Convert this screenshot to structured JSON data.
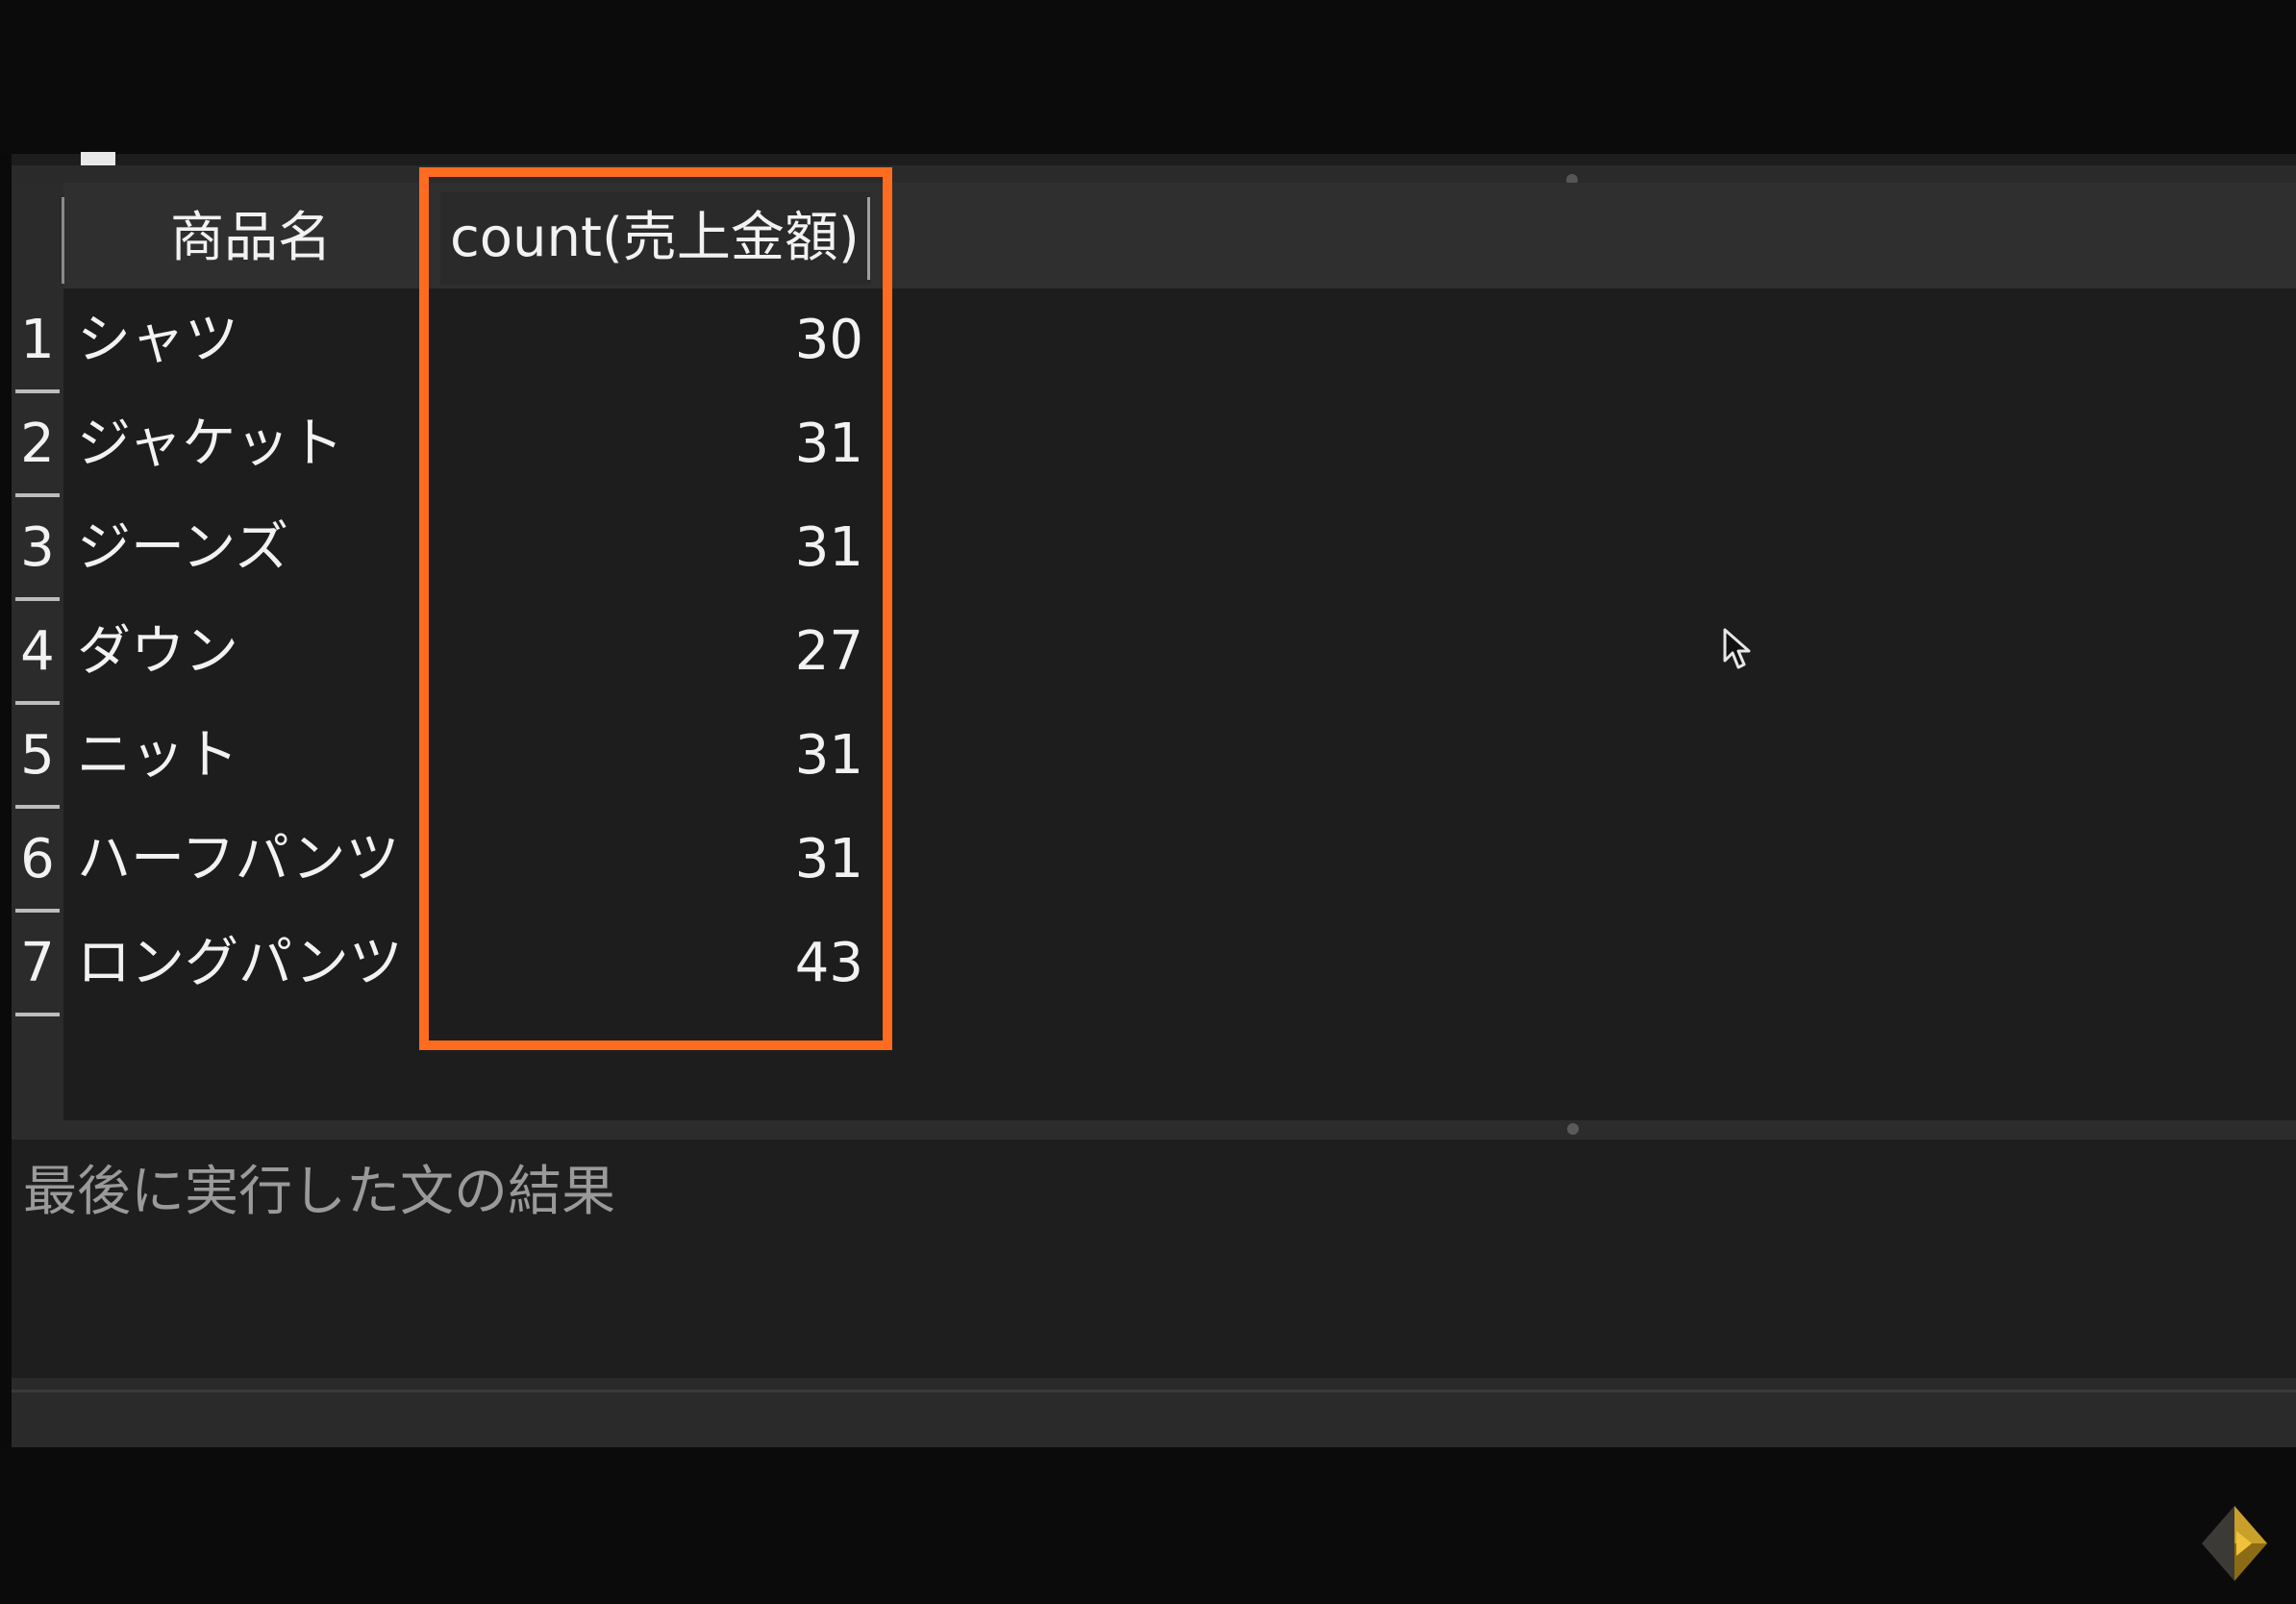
{
  "grid": {
    "columns": {
      "product_name": "商品名",
      "count": "count(売上金額)"
    },
    "rows": [
      {
        "num": "1",
        "name": "シャツ",
        "count": "30"
      },
      {
        "num": "2",
        "name": "ジャケット",
        "count": "31"
      },
      {
        "num": "3",
        "name": "ジーンズ",
        "count": "31"
      },
      {
        "num": "4",
        "name": "ダウン",
        "count": "27"
      },
      {
        "num": "5",
        "name": "ニット",
        "count": "31"
      },
      {
        "num": "6",
        "name": "ハーフパンツ",
        "count": "31"
      },
      {
        "num": "7",
        "name": "ロングパンツ",
        "count": "43"
      }
    ]
  },
  "result_panel": {
    "message": "最後に実行した文の結果"
  },
  "colors": {
    "highlight": "#ff6b1f",
    "background": "#1d1d1d",
    "text": "#f2f2f2"
  },
  "icons": {
    "cursor": "mouse-pointer-icon",
    "logo": "channel-logo-icon"
  }
}
